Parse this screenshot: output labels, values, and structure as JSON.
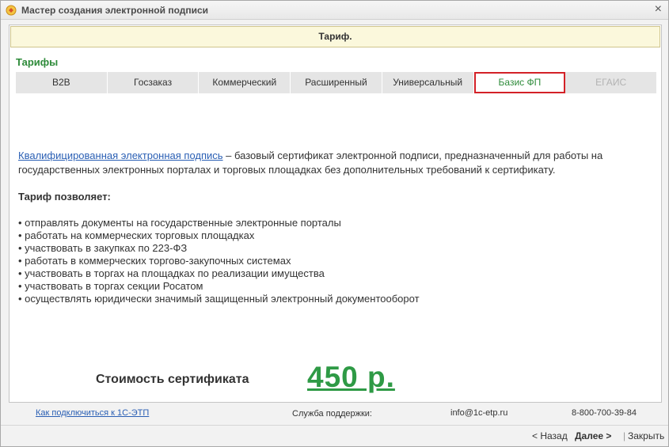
{
  "window": {
    "title": "Мастер создания электронной подписи",
    "close_glyph": "×"
  },
  "banner": {
    "text": "Тариф."
  },
  "section_title": "Тарифы",
  "tabs": [
    {
      "label": "B2B"
    },
    {
      "label": "Госзаказ"
    },
    {
      "label": "Коммерческий"
    },
    {
      "label": "Расширенный"
    },
    {
      "label": "Универсальный"
    },
    {
      "label": "Базис ФП"
    },
    {
      "label": "ЕГАИС"
    }
  ],
  "description": {
    "link_text": "Квалифицированная электронная подпись",
    "text": " – базовый сертификат электронной подписи, предназначенный для работы на государственных электронных порталах и торговых площадках без дополнительных требований к сертификату."
  },
  "allows_title": "Тариф позволяет:",
  "bullets": [
    "• отправлять документы на государственные электронные порталы",
    "• работать на коммерческих торговых площадках",
    "• участвовать в закупках по 223-ФЗ",
    "• работать в коммерческих торгово-закупочных системах",
    "• участвовать в торгах на площадках по реализации имущества",
    "• участвовать в торгах секции Росатом",
    "• осуществлять юридически значимый защищенный электронный документооборот"
  ],
  "cost": {
    "label": "Стоимость сертификата",
    "value": "450 р."
  },
  "footer": {
    "help_link": "Как подключиться к 1С-ЭТП",
    "support_label": "Служба поддержки:",
    "support_email": "info@1c-etp.ru",
    "support_phone": "8-800-700-39-84"
  },
  "nav": {
    "back": "< Назад",
    "next": "Далее >",
    "divider": "|",
    "close": "Закрыть"
  },
  "colors": {
    "accent_green": "#2e8b3a",
    "price_green": "#2e9a45",
    "link_blue": "#2a5fb4",
    "active_tab_border": "#d32127",
    "banner_bg": "#fbf8dc"
  }
}
